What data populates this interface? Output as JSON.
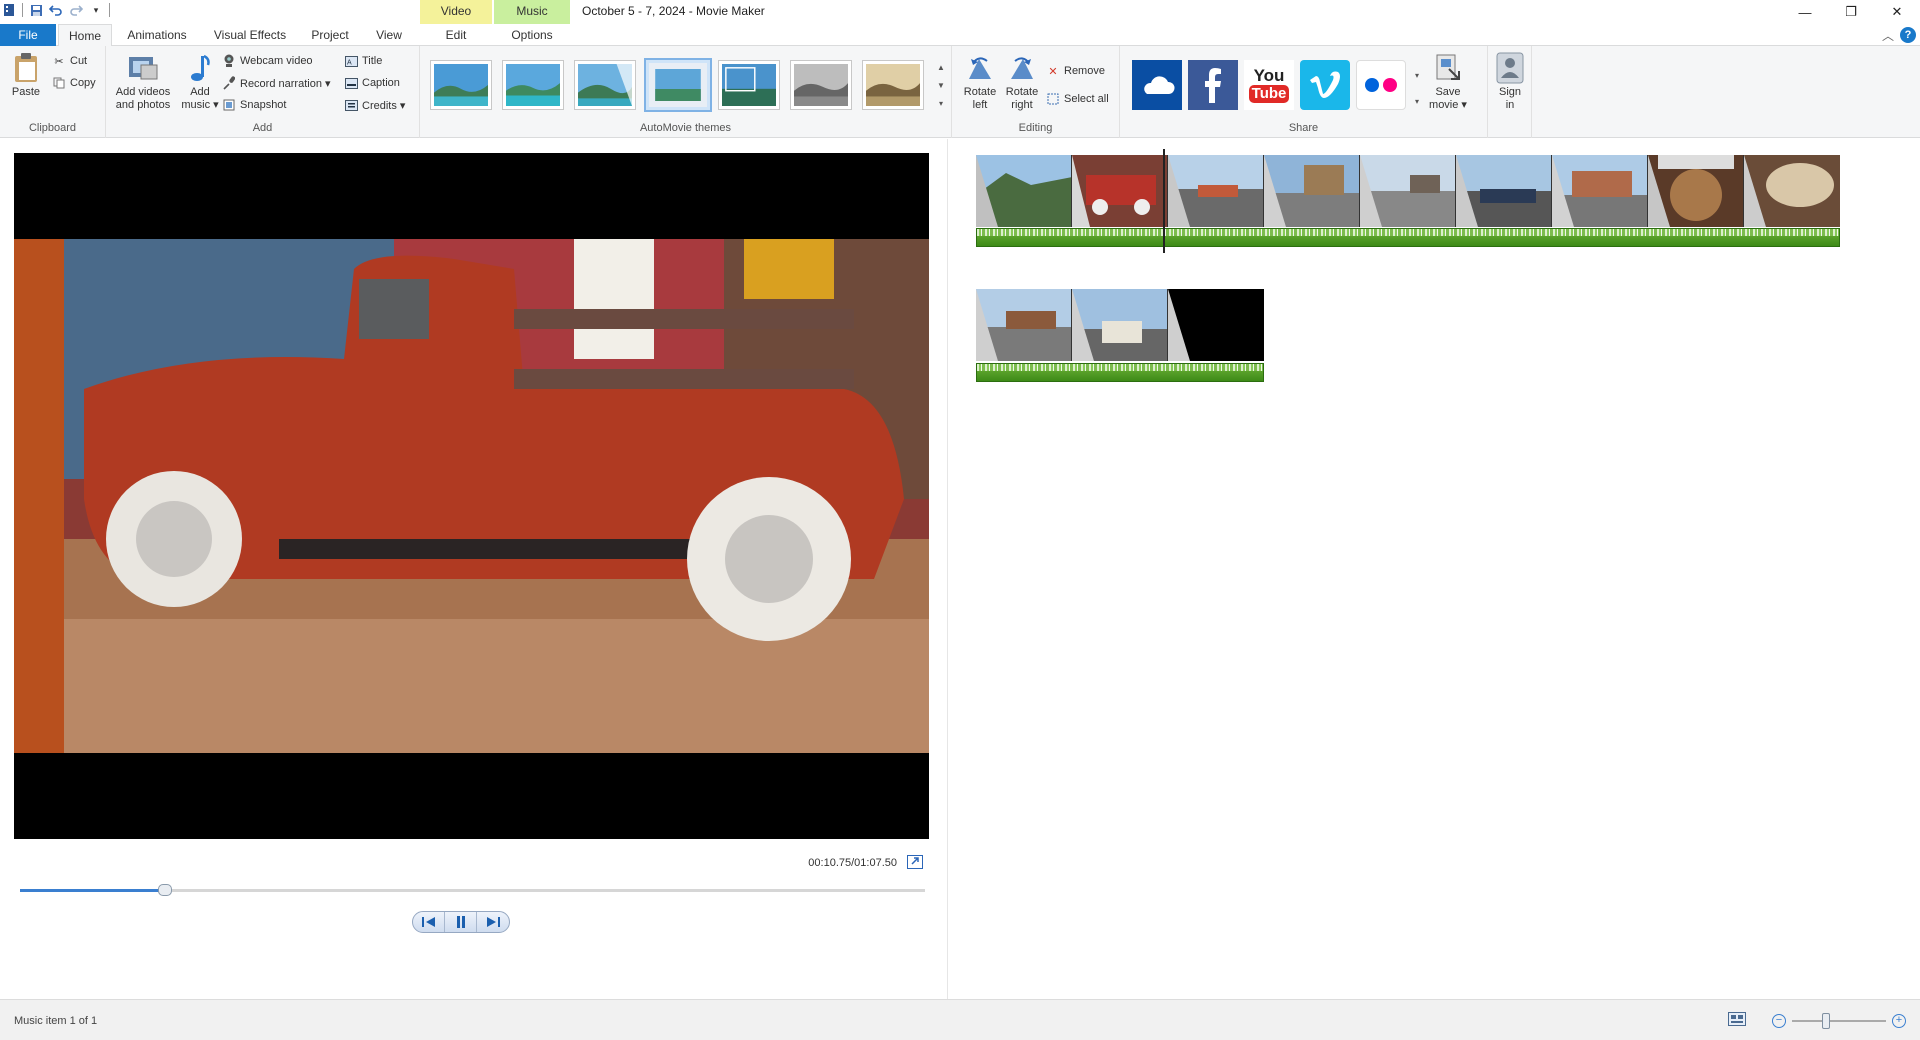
{
  "window": {
    "title": "October 5 - 7, 2024 - Movie Maker",
    "context_tabs": {
      "video_tools": "Video Tools",
      "music_tools": "Music Tools"
    },
    "controls": {
      "minimize": "—",
      "restore": "❐",
      "close": "✕"
    }
  },
  "tabs": {
    "file": "File",
    "home": "Home",
    "animations": "Animations",
    "visual_effects": "Visual Effects",
    "project": "Project",
    "view": "View",
    "edit": "Edit",
    "options": "Options",
    "help": "?"
  },
  "ribbon": {
    "clipboard": {
      "label": "Clipboard",
      "paste": "Paste",
      "cut": "Cut",
      "copy": "Copy"
    },
    "add": {
      "label": "Add",
      "add_videos_line1": "Add videos",
      "add_videos_line2": "and photos",
      "add_music_line1": "Add",
      "add_music_line2": "music ▾",
      "webcam": "Webcam video",
      "narration": "Record narration ▾",
      "snapshot": "Snapshot",
      "title": "Title",
      "caption": "Caption",
      "credits": "Credits ▾"
    },
    "themes": {
      "label": "AutoMovie themes"
    },
    "editing": {
      "label": "Editing",
      "rotate_left_1": "Rotate",
      "rotate_left_2": "left",
      "rotate_right_1": "Rotate",
      "rotate_right_2": "right",
      "remove": "Remove",
      "select_all": "Select all"
    },
    "share": {
      "label": "Share",
      "save_movie_1": "Save",
      "save_movie_2": "movie ▾",
      "sign_in_1": "Sign",
      "sign_in_2": "in",
      "youtube_1": "You",
      "youtube_2": "Tube"
    }
  },
  "player": {
    "timecode": "00:10.75/01:07.50",
    "progress": 0.16
  },
  "status": {
    "text": "Music item 1 of 1",
    "zoom_level": 0.36
  },
  "colors": {
    "accent": "#1979ca",
    "video_tools": "#f4f29a",
    "music_tools": "#c9ef9e",
    "music_strip": "#4f9e24"
  }
}
